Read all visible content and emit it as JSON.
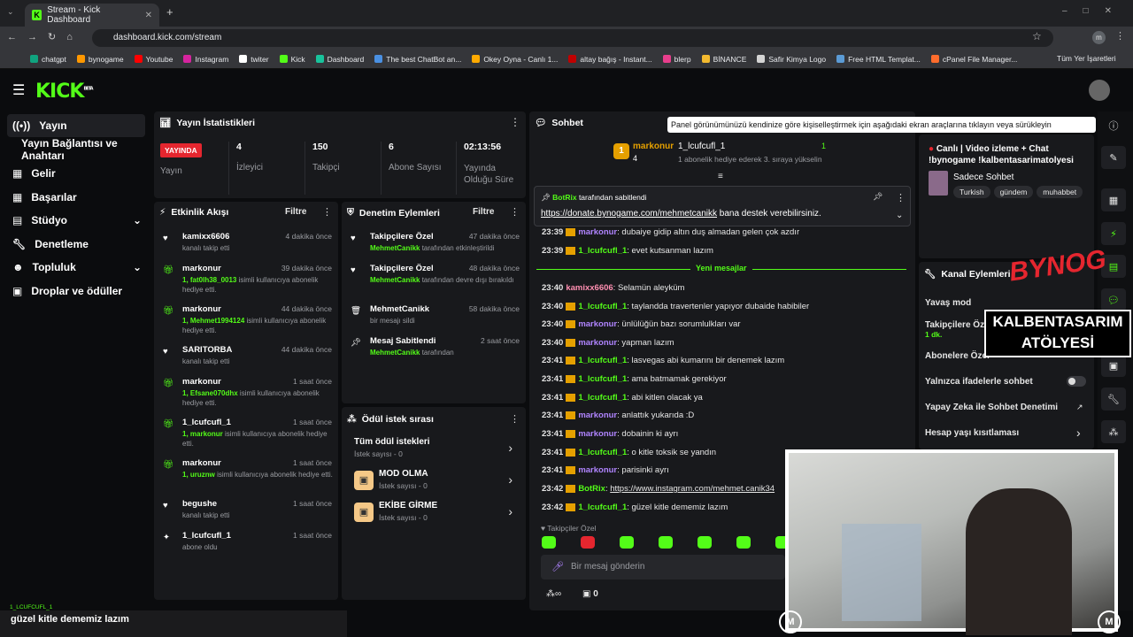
{
  "browser": {
    "tab_title": "Stream - Kick Dashboard",
    "url": "dashboard.kick.com/stream",
    "profile": "m",
    "bookmarks": [
      "chatgpt",
      "bynogame",
      "Youtube",
      "Instagram",
      "twiter",
      "Kick",
      "Dashboard",
      "The best ChatBot an...",
      "Okey Oyna - Canlı 1...",
      "altay bağış - Instant...",
      "blerp",
      "BİNANCE",
      "Safir Kimya Logo",
      "Free HTML Templat...",
      "cPanel File Manager..."
    ],
    "all_bookmarks": "Tüm Yer İşaretleri"
  },
  "brand": {
    "logo": "KICK",
    "badge": "BETA",
    "accent": "#53fc18"
  },
  "sidebar": {
    "items": [
      {
        "label": "Yayın"
      },
      {
        "label": "Yayın Bağlantısı ve Anahtarı"
      },
      {
        "label": "Gelir"
      },
      {
        "label": "Başarılar"
      },
      {
        "label": "Stüdyo"
      },
      {
        "label": "Denetleme"
      },
      {
        "label": "Topluluk"
      },
      {
        "label": "Droplar ve ödüller"
      }
    ]
  },
  "stats": {
    "title": "Yayın İstatistikleri",
    "live_badge": "YAYINDA",
    "live_label": "Yayın",
    "items": [
      {
        "value": "4",
        "label": "İzleyici"
      },
      {
        "value": "150",
        "label": "Takipçi"
      },
      {
        "value": "6",
        "label": "Abone Sayısı"
      },
      {
        "value": "02:13:56",
        "label": "Yayında Olduğu Süre"
      }
    ]
  },
  "activity": {
    "title": "Etkinlik Akışı",
    "filter": "Filtre",
    "items": [
      {
        "name": "kamixx6606",
        "time": "4 dakika önce",
        "sub": "kanalı takip etti",
        "icon": "heart"
      },
      {
        "name": "markonur",
        "time": "39 dakika önce",
        "hl": "1, fat0lh38_0013",
        "sub": " isimli kullanıcıya abonelik hediye etti.",
        "icon": "gift"
      },
      {
        "name": "markonur",
        "time": "44 dakika önce",
        "hl": "1, Mehmet1994124",
        "sub": " isimli kullanıcıya abonelik hediye etti.",
        "icon": "gift"
      },
      {
        "name": "SARITORBA",
        "time": "44 dakika önce",
        "sub": "kanalı takip etti",
        "icon": "heart"
      },
      {
        "name": "markonur",
        "time": "1 saat önce",
        "hl": "1, Efsane070dhx",
        "sub": " isimli kullanıcıya abonelik hediye etti.",
        "icon": "gift"
      },
      {
        "name": "1_lcufcufl_1",
        "time": "1 saat önce",
        "hl": "1, markonur",
        "sub": " isimli kullanıcıya abonelik hediye etti.",
        "icon": "gift"
      },
      {
        "name": "markonur",
        "time": "1 saat önce",
        "hl": "1, uruznw",
        "sub": " isimli kullanıcıya abonelik hediye etti.",
        "icon": "gift"
      },
      {
        "name": "begushe",
        "time": "1 saat önce",
        "sub": "kanalı takip etti",
        "icon": "heart"
      },
      {
        "name": "1_lcufcufl_1",
        "time": "1 saat önce",
        "sub": "abone oldu",
        "icon": "star"
      }
    ]
  },
  "moderation": {
    "title": "Denetim Eylemleri",
    "filter": "Filtre",
    "items": [
      {
        "name": "Takipçilere Özel",
        "time": "47 dakika önce",
        "hl": "MehmetCanikk",
        "sub": " tarafından etkinleştirildi",
        "icon": "heart"
      },
      {
        "name": "Takipçilere Özel",
        "time": "48 dakika önce",
        "hl": "MehmetCanikk",
        "sub": " tarafından devre dışı bırakıldı",
        "icon": "heart"
      },
      {
        "name": "MehmetCanikk",
        "time": "58 dakika önce",
        "hl": "",
        "sub": "bir mesajı sildi",
        "icon": "trash"
      },
      {
        "name": "Mesaj Sabitlendi",
        "time": "2 saat önce",
        "hl": "MehmetCanikk",
        "sub": " tarafından",
        "icon": "pin"
      }
    ]
  },
  "rewards": {
    "title": "Ödül istek sırası",
    "items": [
      {
        "name": "Tüm ödül istekleri",
        "sub": "İstek sayısı - 0"
      },
      {
        "name": "MOD OLMA",
        "sub": "İstek sayısı - 0"
      },
      {
        "name": "EKİBE GİRME",
        "sub": "İstek sayısı - 0"
      }
    ]
  },
  "chat": {
    "title": "Sohbet",
    "tooltip": "Panel görünümünüzü kendinize göre kişiselleştirmek için aşağıdaki ekran araçlarına tıklayın veya sürükleyin",
    "gift": {
      "rank": "1",
      "from": "markonur",
      "from_count": "4",
      "to": "1_lcufcufl_1",
      "to_count": "1",
      "note": "1 abonelik hediye ederek 3. sıraya yükselin"
    },
    "pinned": {
      "by": "BotRix",
      "by_suffix": "tarafından sabitlendi",
      "link": "https://donate.bynogame.com/mehmetcanikk",
      "text": "bana destek verebilirsiniz."
    },
    "new_messages": "Yeni mesajlar",
    "messages": [
      {
        "time": "23:39",
        "user": "markonur",
        "text": "dubaiye gidip altın duş almadan gelen çok azdır",
        "c": "purple"
      },
      {
        "time": "23:39",
        "user": "1_lcufcufl_1",
        "text": "evet kutsanman lazım",
        "c": "green"
      },
      {
        "time": "23:40",
        "user": "kamixx6606",
        "text": "Selamün aleyküm",
        "c": "pink"
      },
      {
        "time": "23:40",
        "user": "1_lcufcufl_1",
        "text": "taylandda travertenler yapıyor dubaide habibiler",
        "c": "green"
      },
      {
        "time": "23:40",
        "user": "markonur",
        "text": "ünlülüğün bazı sorumlulkları var",
        "c": "purple"
      },
      {
        "time": "23:40",
        "user": "markonur",
        "text": "yapman lazım",
        "c": "purple"
      },
      {
        "time": "23:41",
        "user": "1_lcufcufl_1",
        "text": "lasvegas abi kumarını bir denemek lazım",
        "c": "green"
      },
      {
        "time": "23:41",
        "user": "1_lcufcufl_1",
        "text": "ama batmamak gerekiyor",
        "c": "green"
      },
      {
        "time": "23:41",
        "user": "1_lcufcufl_1",
        "text": "abi kitlen olacak ya",
        "c": "green"
      },
      {
        "time": "23:41",
        "user": "markonur",
        "text": "anlattık yukarıda :D",
        "c": "purple"
      },
      {
        "time": "23:41",
        "user": "markonur",
        "text": "dobainin ki ayrı",
        "c": "purple"
      },
      {
        "time": "23:41",
        "user": "1_lcufcufl_1",
        "text": "o kitle toksik se yandın",
        "c": "green"
      },
      {
        "time": "23:41",
        "user": "markonur",
        "text": "parisinki ayrı",
        "c": "purple"
      },
      {
        "time": "23:42",
        "user": "BotRix",
        "text": "https://www.instagram.com/mehmet.canik34",
        "c": "green"
      },
      {
        "time": "23:42",
        "user": "1_lcufcufl_1",
        "text": "güzel kitle dememiz lazım",
        "c": "green"
      }
    ],
    "followers_only": "Takipçiler Özel",
    "input_placeholder": "Bir mesaj gönderin",
    "points": "0"
  },
  "stream_info": {
    "title": "Canlı | Video izleme + Chat !bynogame !kalbentasarimatolyesi",
    "mode": "Sadece Sohbet",
    "tags": [
      "Turkish",
      "gündem",
      "muhabbet"
    ]
  },
  "channel_actions": {
    "title": "Kanal Eylemleri",
    "items": [
      {
        "label": "Yavaş mod"
      },
      {
        "label": "Takipçilere Özel",
        "value": "1 dk."
      },
      {
        "label": "Abonelere Özel"
      },
      {
        "label": "Yalnızca ifadelerle sohbet"
      },
      {
        "label": "Yapay Zeka ile Sohbet Denetimi"
      },
      {
        "label": "Hesap yaşı kısıtlaması"
      }
    ]
  },
  "overlay": {
    "watermark": "BYNOG",
    "brand_line1": "KALBENTASARIM",
    "brand_line2": "ATÖLYESİ",
    "caption_user": "1_LCUFCUFL_1",
    "caption_text": "güzel kitle dememiz lazım"
  }
}
